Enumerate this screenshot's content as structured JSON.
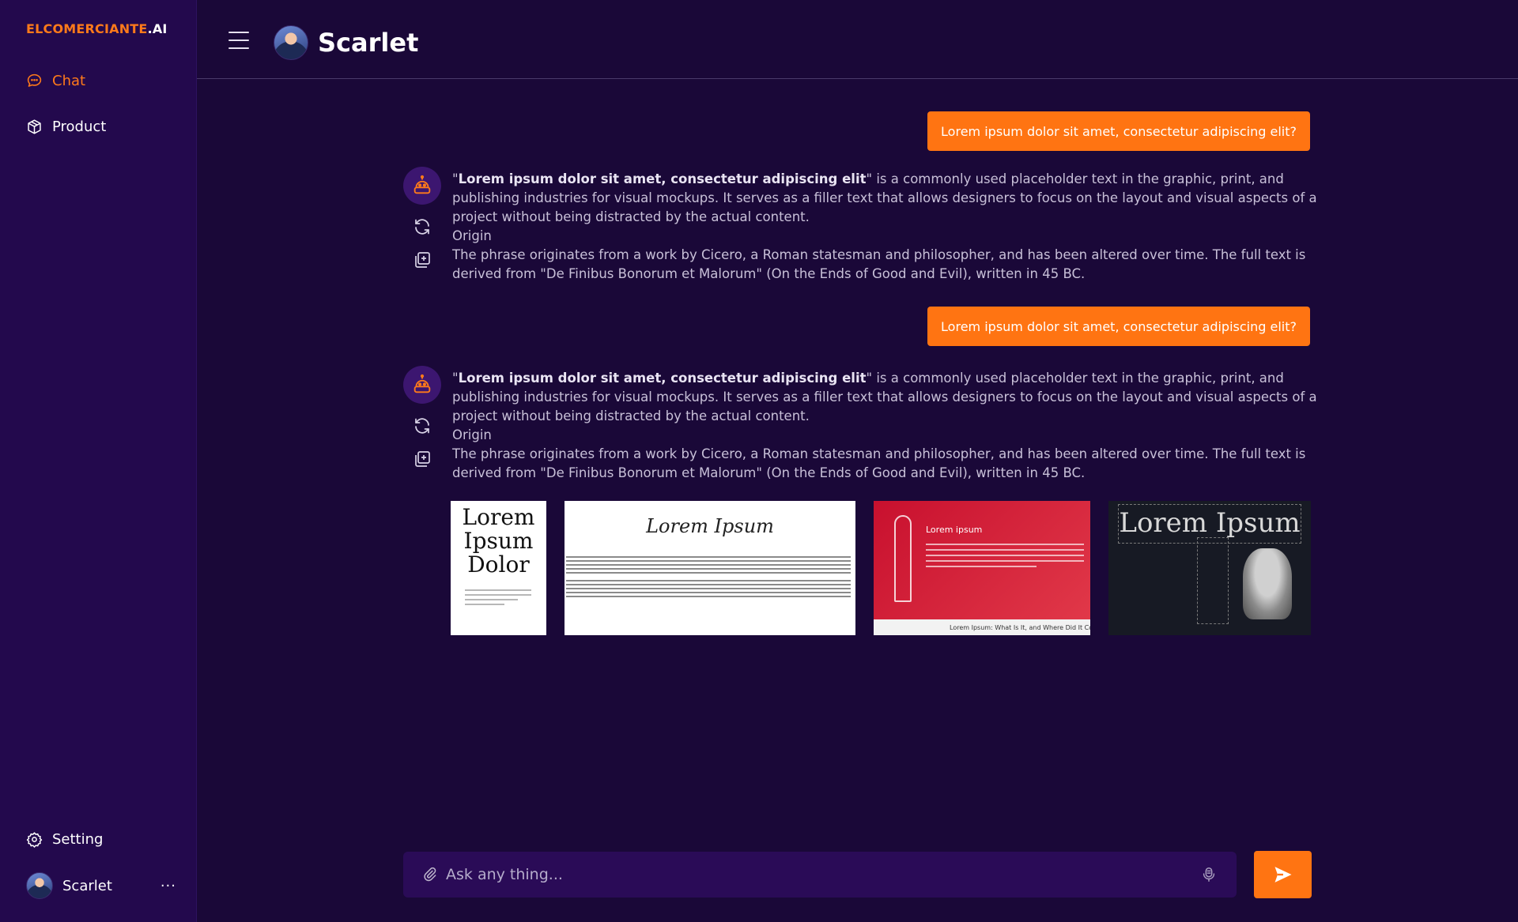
{
  "brand": {
    "main": "ELCOMERCIANTE",
    "suffix": ".AI"
  },
  "sidebar": {
    "items": [
      {
        "label": "Chat",
        "icon": "chat-bubble-icon",
        "active": true
      },
      {
        "label": "Product",
        "icon": "box-icon",
        "active": false
      }
    ],
    "setting_label": "Setting",
    "user": {
      "name": "Scarlet",
      "more": "···"
    }
  },
  "header": {
    "title": "Scarlet"
  },
  "chat": {
    "messages": [
      {
        "role": "user",
        "text": "Lorem ipsum dolor sit amet, consectetur adipiscing elit?"
      },
      {
        "role": "bot",
        "quote_open": "\"",
        "bold": "Lorem ipsum dolor sit amet, consectetur adipiscing elit",
        "rest": "\" is a commonly used placeholder text in the graphic, print, and publishing industries for visual mockups. It serves as a filler text that allows designers to focus on the layout and visual aspects of a project without being distracted by the actual content.",
        "origin_heading": "Origin",
        "origin_text": "The phrase originates from a work by Cicero, a Roman statesman and philosopher, and has been altered over time. The full text is derived from \"De Finibus Bonorum et Malorum\" (On the Ends of Good and Evil), written in 45 BC."
      },
      {
        "role": "user",
        "text": "Lorem ipsum dolor sit amet, consectetur adipiscing elit?"
      },
      {
        "role": "bot",
        "quote_open": "\"",
        "bold": "Lorem ipsum dolor sit amet, consectetur adipiscing elit",
        "rest": "\" is a commonly used placeholder text in the graphic, print, and publishing industries for visual mockups. It serves as a filler text that allows designers to focus on the layout and visual aspects of a project without being distracted by the actual content.",
        "origin_heading": "Origin",
        "origin_text": "The phrase originates from a work by Cicero, a Roman statesman and philosopher, and has been altered over time. The full text is derived from \"De Finibus Bonorum et Malorum\" (On the Ends of Good and Evil), written in 45 BC."
      }
    ],
    "thumbnails": [
      {
        "text": "Lorem Ipsum Dolor"
      },
      {
        "text": "Lorem Ipsum"
      },
      {
        "text": "Lorem ipsum",
        "footer": "Lorem Ipsum: What Is It, and Where Did It Come F"
      },
      {
        "text": "Lorem Ipsum"
      }
    ]
  },
  "composer": {
    "placeholder": "Ask any thing..."
  },
  "colors": {
    "accent": "#ff7412",
    "background": "#1a0838",
    "sidebar": "#23094d"
  }
}
